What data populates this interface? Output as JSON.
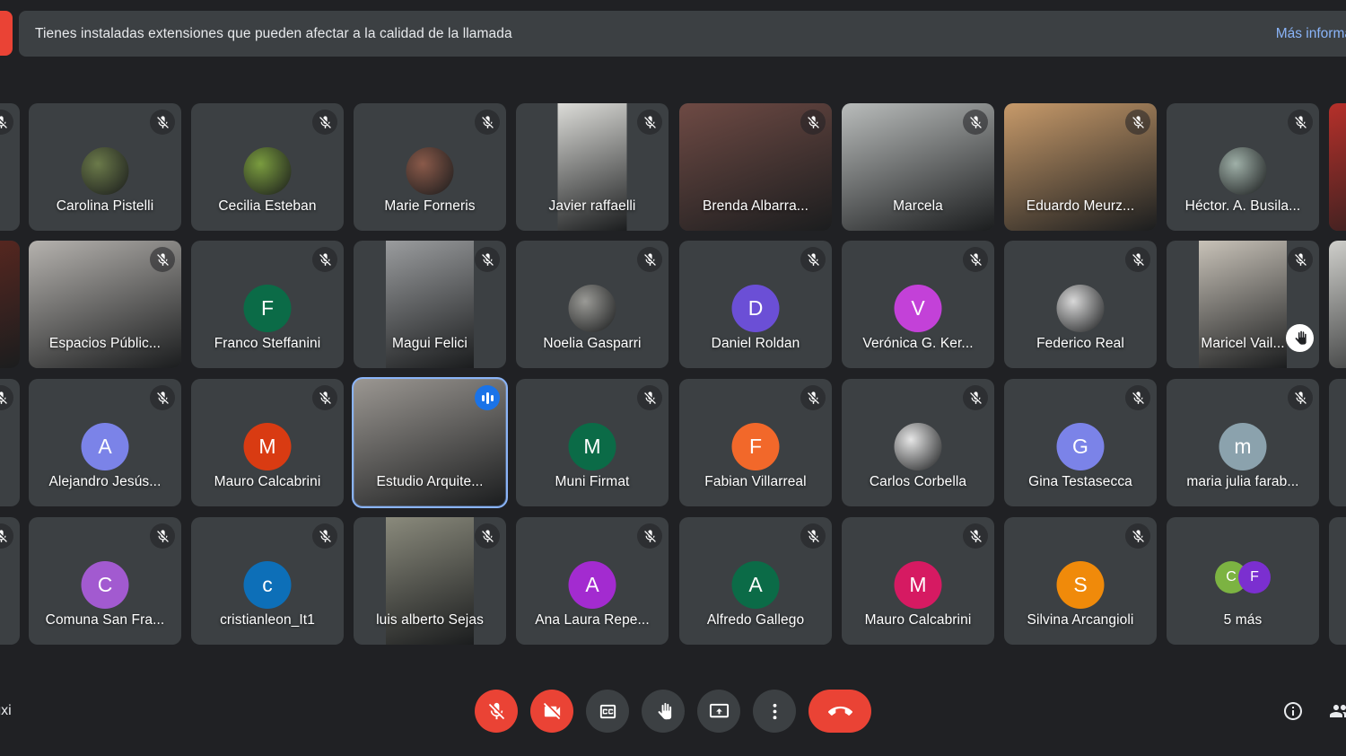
{
  "banner": {
    "message": "Tienes instaladas extensiones que pueden afectar a la calidad de la llamada",
    "link_label": "Más informa"
  },
  "meeting": {
    "code": "g-gxi"
  },
  "grid": {
    "rows": [
      {
        "tiles": [
          {
            "name": "",
            "clip": "left",
            "kind": "avatar",
            "avatar_type": "letter",
            "letter": "",
            "color": "#3c4043",
            "muted": true
          },
          {
            "name": "Carolina Pistelli",
            "kind": "avatar",
            "avatar_type": "photo",
            "color": "#6b7a4a",
            "muted": true
          },
          {
            "name": "Cecilia Esteban",
            "kind": "avatar",
            "avatar_type": "photo",
            "color": "#7a9c3f",
            "muted": true
          },
          {
            "name": "Marie Forneris",
            "kind": "avatar",
            "avatar_type": "photo",
            "color": "#8a5a4a",
            "muted": true
          },
          {
            "name": "Javier raffaelli",
            "kind": "video",
            "video": "narrow",
            "color": "#dcdcd8",
            "muted": true
          },
          {
            "name": "Brenda Albarra...",
            "kind": "video",
            "color": "#6e4a44",
            "muted": true
          },
          {
            "name": "Marcela",
            "kind": "video",
            "color": "#b9bcbb",
            "muted": true
          },
          {
            "name": "Eduardo Meurz...",
            "kind": "video",
            "color": "#c79a6a",
            "muted": true
          },
          {
            "name": "Héctor. A. Busila...",
            "kind": "avatar",
            "avatar_type": "photo",
            "color": "#9fb0a8",
            "muted": true
          },
          {
            "name": "",
            "clip": "right",
            "kind": "video",
            "color": "#b6302a",
            "muted": false
          }
        ]
      },
      {
        "tiles": [
          {
            "name": "",
            "clip": "left",
            "kind": "video",
            "color": "#6a2a20",
            "muted": false
          },
          {
            "name": "Espacios Públic...",
            "kind": "video",
            "color": "#b5b2ae",
            "muted": true
          },
          {
            "name": "Franco Steffanini",
            "kind": "avatar",
            "avatar_type": "letter",
            "letter": "F",
            "color": "#0b6b47",
            "muted": true
          },
          {
            "name": "Magui Felici",
            "kind": "video",
            "video": "narrow2",
            "color": "#9a9c9e",
            "muted": true
          },
          {
            "name": "Noelia Gasparri",
            "kind": "avatar",
            "avatar_type": "photo",
            "color": "#9a9a96",
            "muted": true
          },
          {
            "name": "Daniel Roldan",
            "kind": "avatar",
            "avatar_type": "letter",
            "letter": "D",
            "color": "#6b4fd6",
            "muted": true
          },
          {
            "name": "Verónica G. Ker...",
            "kind": "avatar",
            "avatar_type": "letter",
            "letter": "V",
            "color": "#c341d8",
            "muted": true
          },
          {
            "name": "Federico Real",
            "kind": "avatar",
            "avatar_type": "photo",
            "color": "#d8d8d8",
            "muted": true
          },
          {
            "name": "Maricel Vail...",
            "kind": "video",
            "video": "narrow2",
            "color": "#c8c2b8",
            "muted": true,
            "hand_raised": true
          },
          {
            "name": "",
            "clip": "right",
            "kind": "video",
            "color": "#cfcfcb",
            "muted": false
          }
        ]
      },
      {
        "tiles": [
          {
            "name": "",
            "clip": "left",
            "kind": "avatar",
            "avatar_type": "letter",
            "letter": "",
            "color": "#3c4043",
            "muted": true
          },
          {
            "name": "Alejandro Jesús...",
            "kind": "avatar",
            "avatar_type": "letter",
            "letter": "A",
            "color": "#7b83e8",
            "muted": true
          },
          {
            "name": "Mauro Calcabrini",
            "kind": "avatar",
            "avatar_type": "letter",
            "letter": "M",
            "color": "#d93b12",
            "muted": true
          },
          {
            "name": "Estudio Arquite...",
            "kind": "video",
            "color": "#9b9792",
            "muted": false,
            "speaking": true
          },
          {
            "name": "Muni Firmat",
            "kind": "avatar",
            "avatar_type": "letter",
            "letter": "M",
            "color": "#0b6b47",
            "muted": true
          },
          {
            "name": "Fabian Villarreal",
            "kind": "avatar",
            "avatar_type": "letter",
            "letter": "F",
            "color": "#f2682a",
            "muted": true
          },
          {
            "name": "Carlos Corbella",
            "kind": "avatar",
            "avatar_type": "photo",
            "color": "#e6e6e6",
            "muted": true
          },
          {
            "name": "Gina Testasecca",
            "kind": "avatar",
            "avatar_type": "letter",
            "letter": "G",
            "color": "#7b83e8",
            "muted": true
          },
          {
            "name": "maria julia farab...",
            "kind": "avatar",
            "avatar_type": "letter",
            "letter": "m",
            "color": "#8ba2ad",
            "muted": true
          },
          {
            "name": "",
            "clip": "right",
            "kind": "avatar",
            "avatar_type": "letter",
            "letter": "",
            "color": "#3c4043",
            "muted": true
          }
        ]
      },
      {
        "tiles": [
          {
            "name": "",
            "clip": "left",
            "kind": "avatar",
            "avatar_type": "letter",
            "letter": "",
            "color": "#3c4043",
            "muted": true
          },
          {
            "name": "Comuna San Fra...",
            "kind": "avatar",
            "avatar_type": "letter",
            "letter": "C",
            "color": "#a25ad0",
            "muted": true
          },
          {
            "name": "cristianleon_It1",
            "kind": "avatar",
            "avatar_type": "letter",
            "letter": "c",
            "color": "#0d6fb8",
            "muted": true
          },
          {
            "name": "luis alberto Sejas",
            "kind": "video",
            "video": "narrow2",
            "color": "#8a8a7c",
            "muted": true
          },
          {
            "name": "Ana Laura Repe...",
            "kind": "avatar",
            "avatar_type": "letter",
            "letter": "A",
            "color": "#a32bd0",
            "muted": true
          },
          {
            "name": "Alfredo Gallego",
            "kind": "avatar",
            "avatar_type": "letter",
            "letter": "A",
            "color": "#0b6b47",
            "muted": true
          },
          {
            "name": "Mauro Calcabrini",
            "kind": "avatar",
            "avatar_type": "letter",
            "letter": "M",
            "color": "#d61a62",
            "muted": true
          },
          {
            "name": "Silvina Arcangioli",
            "kind": "avatar",
            "avatar_type": "letter",
            "letter": "S",
            "color": "#f08a0a",
            "muted": true
          },
          {
            "name": "5 más",
            "kind": "more",
            "more_avatars": [
              {
                "letter": "C",
                "color": "#7cb342"
              },
              {
                "letter": "F",
                "color": "#7b2fd0"
              }
            ],
            "muted": false
          },
          {
            "name": "",
            "clip": "right",
            "kind": "avatar",
            "avatar_type": "letter",
            "letter": "",
            "color": "#3c4043",
            "muted": true
          }
        ]
      }
    ]
  },
  "controls": [
    {
      "name": "microphone-off-button",
      "icon": "mic-off",
      "style": "danger",
      "label": "Desactivar micrófono"
    },
    {
      "name": "camera-off-button",
      "icon": "cam-off",
      "style": "danger",
      "label": "Desactivar cámara"
    },
    {
      "name": "captions-button",
      "icon": "cc",
      "style": "normal",
      "label": "Subtítulos"
    },
    {
      "name": "raise-hand-button",
      "icon": "hand",
      "style": "normal",
      "label": "Levantar la mano"
    },
    {
      "name": "present-screen-button",
      "icon": "present",
      "style": "normal",
      "label": "Presentar ahora"
    },
    {
      "name": "more-options-button",
      "icon": "dots",
      "style": "normal",
      "label": "Más opciones"
    },
    {
      "name": "end-call-button",
      "icon": "hangup",
      "style": "hangup",
      "label": "Salir de la llamada"
    }
  ],
  "right_icons": [
    {
      "name": "meeting-details-icon",
      "icon": "info",
      "label": "Detalles de la reunión"
    },
    {
      "name": "people-icon",
      "icon": "people",
      "label": "Mostrar a todos"
    }
  ]
}
